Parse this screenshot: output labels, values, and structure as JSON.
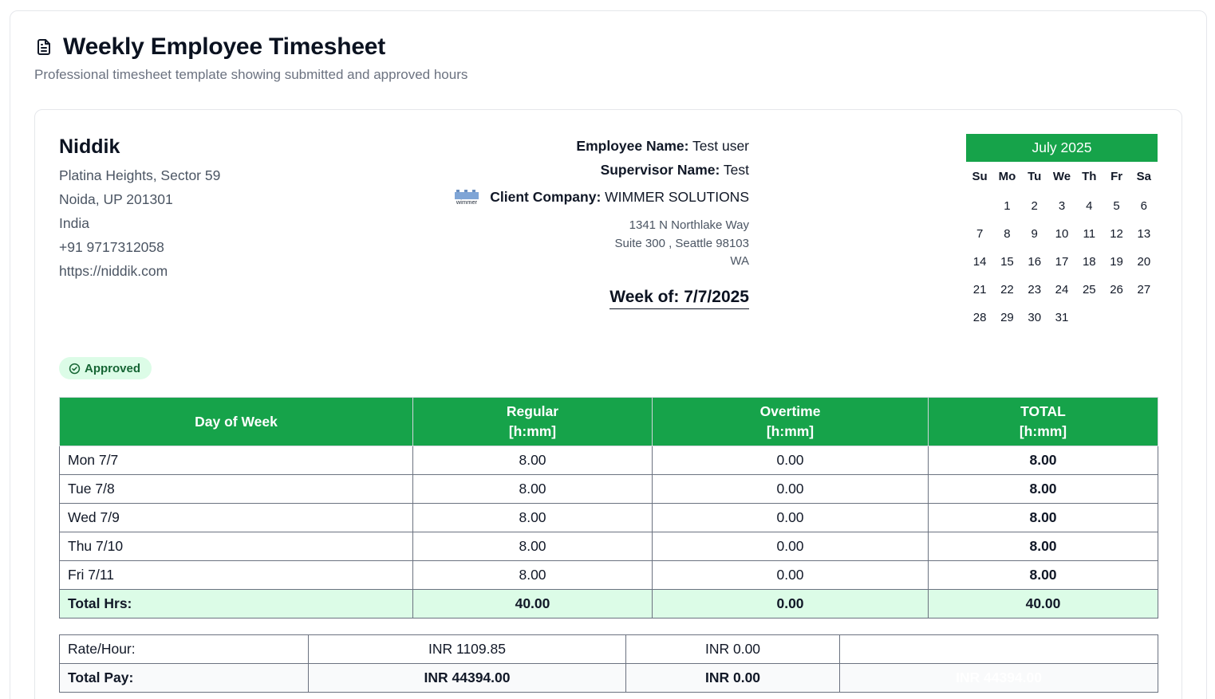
{
  "page": {
    "title": "Weekly Employee Timesheet",
    "subtitle": "Professional timesheet template showing submitted and approved hours"
  },
  "company": {
    "name": "Niddik",
    "address_line1": "Platina Heights, Sector 59",
    "address_line2": "Noida, UP 201301",
    "country": "India",
    "phone": "+91 9717312058",
    "website": "https://niddik.com"
  },
  "employee": {
    "name_label": "Employee Name:",
    "name": "Test user",
    "supervisor_label": "Supervisor Name:",
    "supervisor": "Test",
    "client_label": "Client Company:",
    "client": "WIMMER SOLUTIONS",
    "client_logo_text": "wimmer",
    "client_addr1": "1341 N Northlake Way",
    "client_addr2": "Suite 300 , Seattle 98103",
    "client_addr3": "WA",
    "week_of": "Week of: 7/7/2025"
  },
  "calendar": {
    "month": "July 2025",
    "weekdays": [
      "Su",
      "Mo",
      "Tu",
      "We",
      "Th",
      "Fr",
      "Sa"
    ],
    "leading_blanks": 1,
    "days": [
      1,
      2,
      3,
      4,
      5,
      6,
      7,
      8,
      9,
      10,
      11,
      12,
      13,
      14,
      15,
      16,
      17,
      18,
      19,
      20,
      21,
      22,
      23,
      24,
      25,
      26,
      27,
      28,
      29,
      30,
      31
    ]
  },
  "status": {
    "label": "Approved",
    "color": "#16a34a"
  },
  "table": {
    "headers": {
      "day": "Day of Week",
      "regular_1": "Regular",
      "regular_2": "[h:mm]",
      "overtime_1": "Overtime",
      "overtime_2": "[h:mm]",
      "total_1": "TOTAL",
      "total_2": "[h:mm]"
    },
    "rows": [
      {
        "day": "Mon 7/7",
        "regular": "8.00",
        "overtime": "0.00",
        "total": "8.00"
      },
      {
        "day": "Tue 7/8",
        "regular": "8.00",
        "overtime": "0.00",
        "total": "8.00"
      },
      {
        "day": "Wed 7/9",
        "regular": "8.00",
        "overtime": "0.00",
        "total": "8.00"
      },
      {
        "day": "Thu 7/10",
        "regular": "8.00",
        "overtime": "0.00",
        "total": "8.00"
      },
      {
        "day": "Fri 7/11",
        "regular": "8.00",
        "overtime": "0.00",
        "total": "8.00"
      }
    ],
    "totals": {
      "label": "Total Hrs:",
      "regular": "40.00",
      "overtime": "0.00",
      "total": "40.00"
    }
  },
  "pay": {
    "rate_label": "Rate/Hour:",
    "rate_regular": "INR 1109.85",
    "rate_overtime": "INR 0.00",
    "rate_total": "",
    "total_label": "Total Pay:",
    "total_regular": "INR 44394.00",
    "total_overtime": "INR 0.00",
    "grand_total": "INR 44394.00"
  },
  "colors": {
    "accent_green": "#16a34a",
    "light_green": "#dcfce7",
    "alert_red": "#dc2626"
  }
}
